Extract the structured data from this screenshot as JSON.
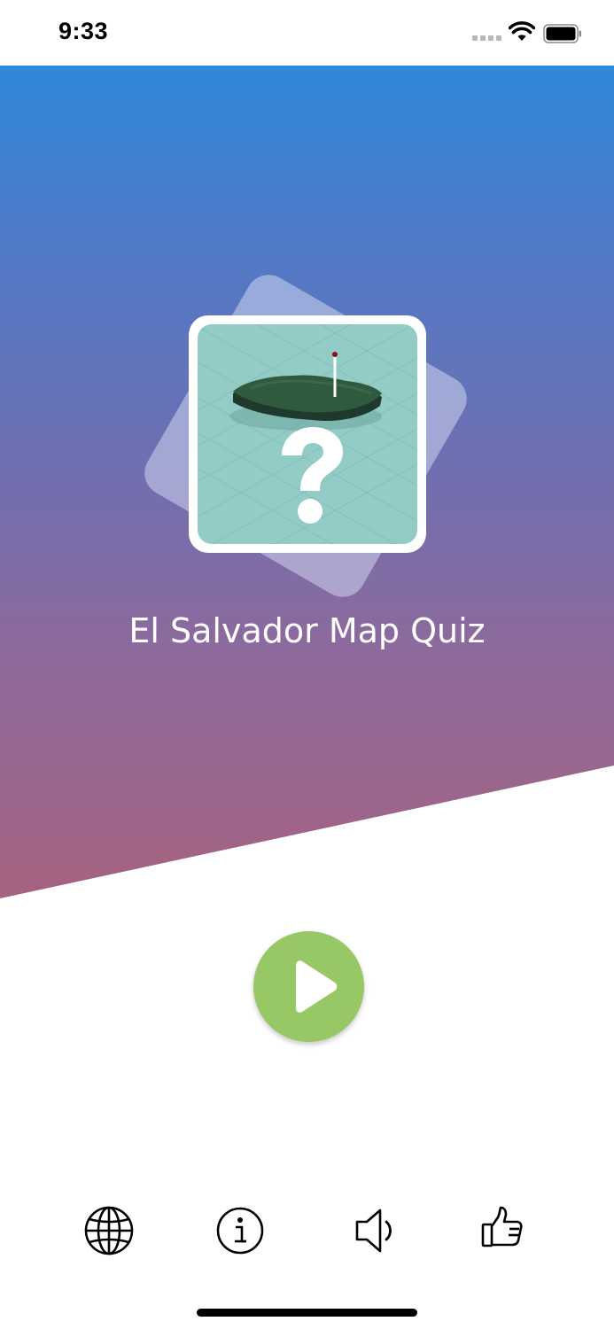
{
  "status_bar": {
    "time": "9:33"
  },
  "app": {
    "title": "El Salvador Map Quiz"
  },
  "colors": {
    "gradient_top": "#2f88db",
    "gradient_bottom": "#a6627f",
    "play_button": "#98c765",
    "icon_tile": "#93ccc6"
  },
  "icons": {
    "app_icon": "map-quiz-question-icon",
    "play": "play-icon",
    "toolbar": [
      "globe-icon",
      "info-icon",
      "speaker-icon",
      "thumbs-up-icon"
    ]
  }
}
